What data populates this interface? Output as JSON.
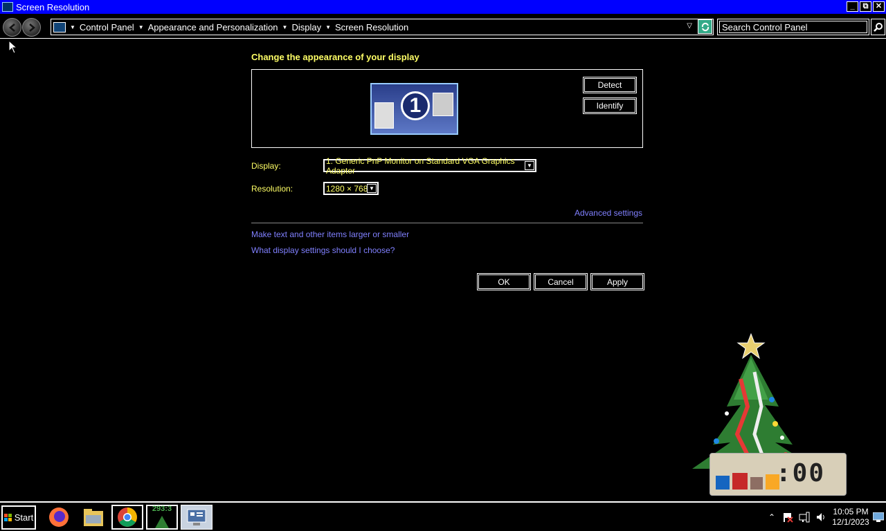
{
  "window": {
    "title": "Screen Resolution",
    "controls": {
      "minimize": "_",
      "maximize": "⧉",
      "close": "✕"
    }
  },
  "nav": {
    "back_icon": "back-arrow-icon",
    "forward_icon": "forward-arrow-icon",
    "breadcrumbs": [
      "Control Panel",
      "Appearance and Personalization",
      "Display",
      "Screen Resolution"
    ],
    "search_placeholder": "Search Control Panel"
  },
  "main": {
    "heading": "Change the appearance of your display",
    "monitor_number": "1",
    "detect_label": "Detect",
    "identify_label": "Identify",
    "display_label": "Display:",
    "display_value": "1. Generic PnP Monitor on Standard VGA Graphics Adapter",
    "resolution_label": "Resolution:",
    "resolution_value": "1280 × 768",
    "advanced_link": "Advanced settings",
    "link_text_size": "Make text and other items larger or smaller",
    "link_help": "What display settings should I choose?",
    "ok_label": "OK",
    "cancel_label": "Cancel",
    "apply_label": "Apply"
  },
  "gadget": {
    "digits": ":00"
  },
  "taskbar": {
    "start_label": "Start",
    "counter_text": "293:3",
    "time": "10:05 PM",
    "date": "12/1/2023"
  },
  "colors": {
    "titlebar": "#0000ff",
    "heading": "#ffff66",
    "link": "#8080ff"
  }
}
